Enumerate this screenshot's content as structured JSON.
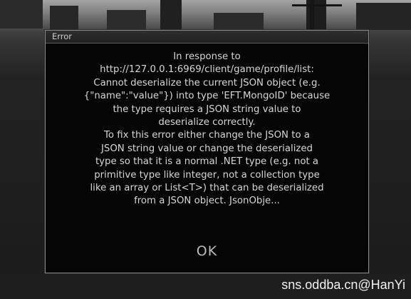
{
  "dialog": {
    "title": "Error",
    "message": "In response to\nhttp://127.0.0.1:6969/client/game/profile/list:\nCannot deserialize the current JSON object (e.g.\n{\"name\":\"value\"}) into type 'EFT.MongoID' because\nthe type requires a JSON string value to\ndeserialize correctly.\nTo fix this error either change the JSON to a\nJSON string value or change the deserialized\ntype so that it is a normal .NET type (e.g. not a\nprimitive type like integer, not a collection type\nlike an array or List<T>) that can be deserialized\nfrom a JSON object. JsonObje...",
    "ok_label": "OK"
  },
  "watermark": "sns.oddba.cn@HanYi",
  "colors": {
    "dialog_bg": "#050505",
    "dialog_border": "#8a8a8a",
    "text": "#d6d6d6"
  }
}
